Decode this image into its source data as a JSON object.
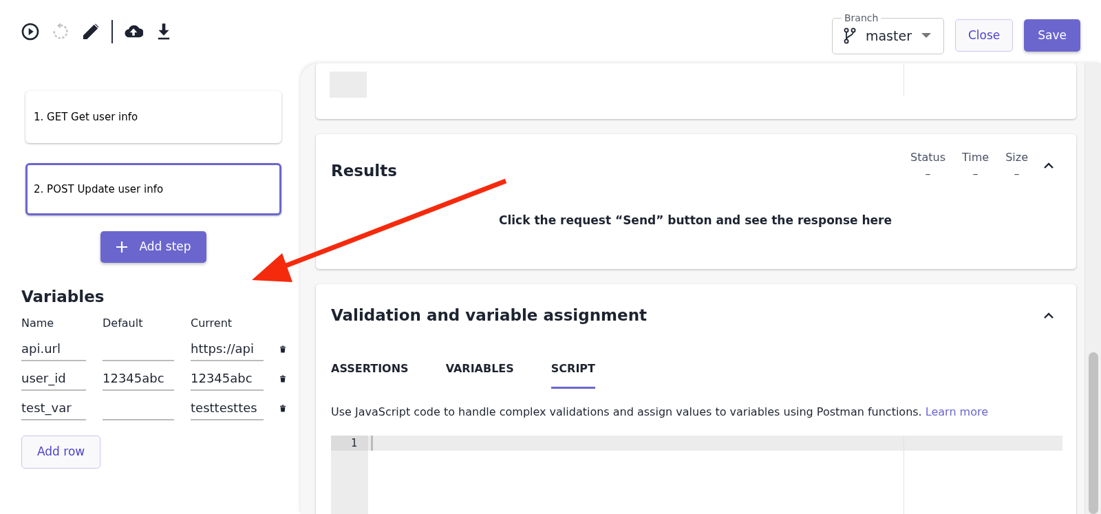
{
  "toolbar": {
    "icons": [
      {
        "kind": "run",
        "disabled": false
      },
      {
        "kind": "reset",
        "disabled": true
      },
      {
        "kind": "edit",
        "disabled": false
      },
      {
        "kind": "upload",
        "disabled": false
      },
      {
        "kind": "download",
        "disabled": false
      }
    ]
  },
  "branch": {
    "label": "Branch",
    "value": "master"
  },
  "header_buttons": [
    {
      "kind": "outline",
      "label": "Close"
    },
    {
      "kind": "primary",
      "label": "Save"
    }
  ],
  "steps": [
    {
      "label": "1. GET Get user info",
      "selected": false
    },
    {
      "label": "2. POST Update user info",
      "selected": true
    }
  ],
  "add_step_button": "Add step",
  "variables": {
    "title": "Variables",
    "columns": [
      "Name",
      "Default",
      "Current"
    ],
    "rows": [
      {
        "name": "api.url",
        "default": "",
        "current": "https://api"
      },
      {
        "name": "user_id",
        "default": "12345abc",
        "current": "12345abc"
      },
      {
        "name": "test_var",
        "default": "",
        "current": "testtesttes"
      }
    ],
    "add_row_button": "Add row"
  },
  "results": {
    "title": "Results",
    "columns": [
      {
        "label": "Status",
        "value": "–"
      },
      {
        "label": "Time",
        "value": "–"
      },
      {
        "label": "Size",
        "value": "–"
      }
    ],
    "message": "Click the request “Send” button and see the response here"
  },
  "validation": {
    "title": "Validation and variable assignment",
    "tabs": [
      {
        "label": "ASSERTIONS",
        "selected": false
      },
      {
        "label": "VARIABLES",
        "selected": false
      },
      {
        "label": "SCRIPT",
        "selected": true
      }
    ],
    "description": "Use JavaScript code to handle complex validations and assign values to variables using Postman functions.",
    "learn_more": "Learn more",
    "editor": {
      "line_numbers": [
        "1"
      ]
    }
  }
}
